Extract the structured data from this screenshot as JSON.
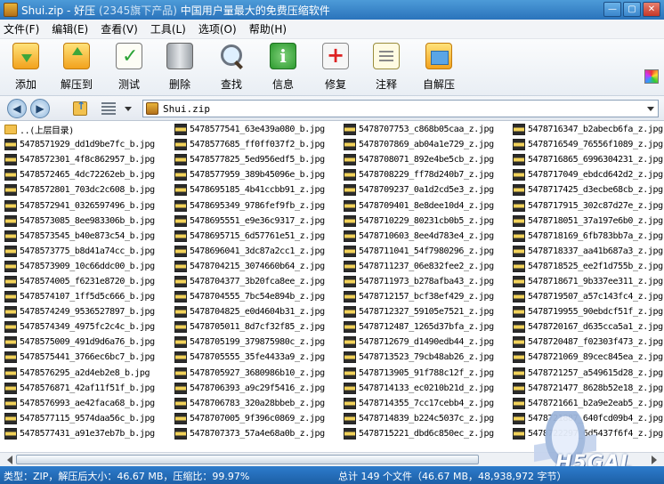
{
  "window": {
    "title_main": "Shui.zip - 好压",
    "title_dim": "(2345旗下产品)",
    "title_tail": "中国用户量最大的免费压缩软件",
    "controls": [
      "—",
      "▢",
      "✕"
    ]
  },
  "menu": {
    "items": [
      "文件(F)",
      "编辑(E)",
      "查看(V)",
      "工具(L)",
      "选项(O)",
      "帮助(H)"
    ]
  },
  "toolbar": {
    "buttons": [
      {
        "label": "添加",
        "icon": "add-archive-icon"
      },
      {
        "label": "解压到",
        "icon": "extract-icon"
      },
      {
        "label": "测试",
        "icon": "test-icon"
      },
      {
        "label": "删除",
        "icon": "delete-icon"
      },
      {
        "label": "查找",
        "icon": "find-icon"
      },
      {
        "label": "信息",
        "icon": "info-icon"
      },
      {
        "label": "修复",
        "icon": "repair-icon"
      },
      {
        "label": "注释",
        "icon": "comment-icon"
      },
      {
        "label": "自解压",
        "icon": "sfx-icon"
      }
    ]
  },
  "address": {
    "back": "◀",
    "forward": "▶",
    "path": "Shui.zip"
  },
  "files": {
    "parent_label": "..(上层目录)",
    "columns": [
      [
        "5478571929_dd1d9be7fc_b.jpg",
        "5478572301_4f8c862957_b.jpg",
        "5478572465_4dc72262eb_b.jpg",
        "5478572801_703dc2c608_b.jpg",
        "5478572941_0326597496_b.jpg",
        "5478573085_8ee983306b_b.jpg",
        "5478573545_b40e873c54_b.jpg",
        "5478573775_b8d41a74cc_b.jpg",
        "5478573909_10c66ddc00_b.jpg",
        "5478574005_f6231e8720_b.jpg",
        "5478574107_1ff5d5c666_b.jpg",
        "5478574249_9536527897_b.jpg",
        "5478574349_4975fc2c4c_b.jpg",
        "5478575009_491d9d6a76_b.jpg",
        "5478575441_3766ec6bc7_b.jpg",
        "5478576295_a2d4eb2e8_b.jpg",
        "5478576871_42af11f51f_b.jpg",
        "5478576993_ae42faca68_b.jpg",
        "5478577115_9574daa56c_b.jpg",
        "5478577431_a91e37eb7b_b.jpg"
      ],
      [
        "5478577541_63e439a080_b.jpg",
        "5478577685_ff0ff037f2_b.jpg",
        "5478577825_5ed956edf5_b.jpg",
        "5478577959_389b45096e_b.jpg",
        "5478695185_4b41ccbb91_z.jpg",
        "5478695349_9786fef9fb_z.jpg",
        "5478695551_e9e36c9317_z.jpg",
        "5478695715_6d57761e51_z.jpg",
        "5478696041_3dc87a2cc1_z.jpg",
        "5478704215_3074660b64_z.jpg",
        "5478704377_3b20fca8ee_z.jpg",
        "5478704555_7bc54e894b_z.jpg",
        "5478704825_e0d4604b31_z.jpg",
        "5478705011_8d7cf32f85_z.jpg",
        "5478705199_379875980c_z.jpg",
        "5478705555_35fe4433a9_z.jpg",
        "5478705927_3680986b10_z.jpg",
        "5478706393_a9c29f5416_z.jpg",
        "5478706783_320a28bbeb_z.jpg",
        "5478707005_9f396c0869_z.jpg",
        "5478707373_57a4e68a0b_z.jpg"
      ],
      [
        "5478707753_c868b05caa_z.jpg",
        "5478707869_ab04a1e729_z.jpg",
        "5478708071_892e4be5cb_z.jpg",
        "5478708229_ff78d240b7_z.jpg",
        "5478709237_0a1d2cd5e3_z.jpg",
        "5478709401_8e8dee10d4_z.jpg",
        "5478710229_80231cb0b5_z.jpg",
        "5478710603_8ee4d783e4_z.jpg",
        "5478711041_54f7980296_z.jpg",
        "5478711237_06e832fee2_z.jpg",
        "5478711973_b278afba43_z.jpg",
        "5478712157_bcf38ef429_z.jpg",
        "5478712327_59105e7521_z.jpg",
        "5478712487_1265d37bfa_z.jpg",
        "5478712679_d1490edb44_z.jpg",
        "5478713523_79cb48ab26_z.jpg",
        "5478713905_91f788c12f_z.jpg",
        "5478714133_ec0210b21d_z.jpg",
        "5478714355_7cc17cebb4_z.jpg",
        "5478714839_b224c5037c_z.jpg",
        "5478715221_dbd6c850ec_z.jpg"
      ],
      [
        "5478716347_b2abecb6fa_z.jpg",
        "5478716549_76556f1089_z.jpg",
        "5478716865_6996304231_z.jpg",
        "5478717049_ebdcd642d2_z.jpg",
        "5478717425_d3ecbe68cb_z.jpg",
        "5478717915_302c87d27e_z.jpg",
        "5478718051_37a197e6b0_z.jpg",
        "5478718169_6fb783bb7a_z.jpg",
        "5478718337_aa41b687a3_z.jpg",
        "5478718525_ee2f1d755b_z.jpg",
        "5478718671_9b337ee311_z.jpg",
        "5478719507_a57c143fc4_z.jpg",
        "5478719955_90ebdcf51f_z.jpg",
        "5478720167_d635cca5a1_z.jpg",
        "5478720487_f02303f473_z.jpg",
        "5478721069_89cec845ea_z.jpg",
        "5478721257_a549615d28_z.jpg",
        "5478721477_8628b52e18_z.jpg",
        "5478721661_b2a9e2eab5_z.jpg",
        "5478721887_640fcd09b4_z.jpg",
        "5478722297_6d5437f6f4_z.jpg"
      ]
    ]
  },
  "status": {
    "left": "类型：ZIP，解压后大小：46.67 MB，压缩比：99.97%",
    "right": "总计 149 个文件（46.67 MB，48,938,972 字节）"
  },
  "watermark": "H5GAL"
}
